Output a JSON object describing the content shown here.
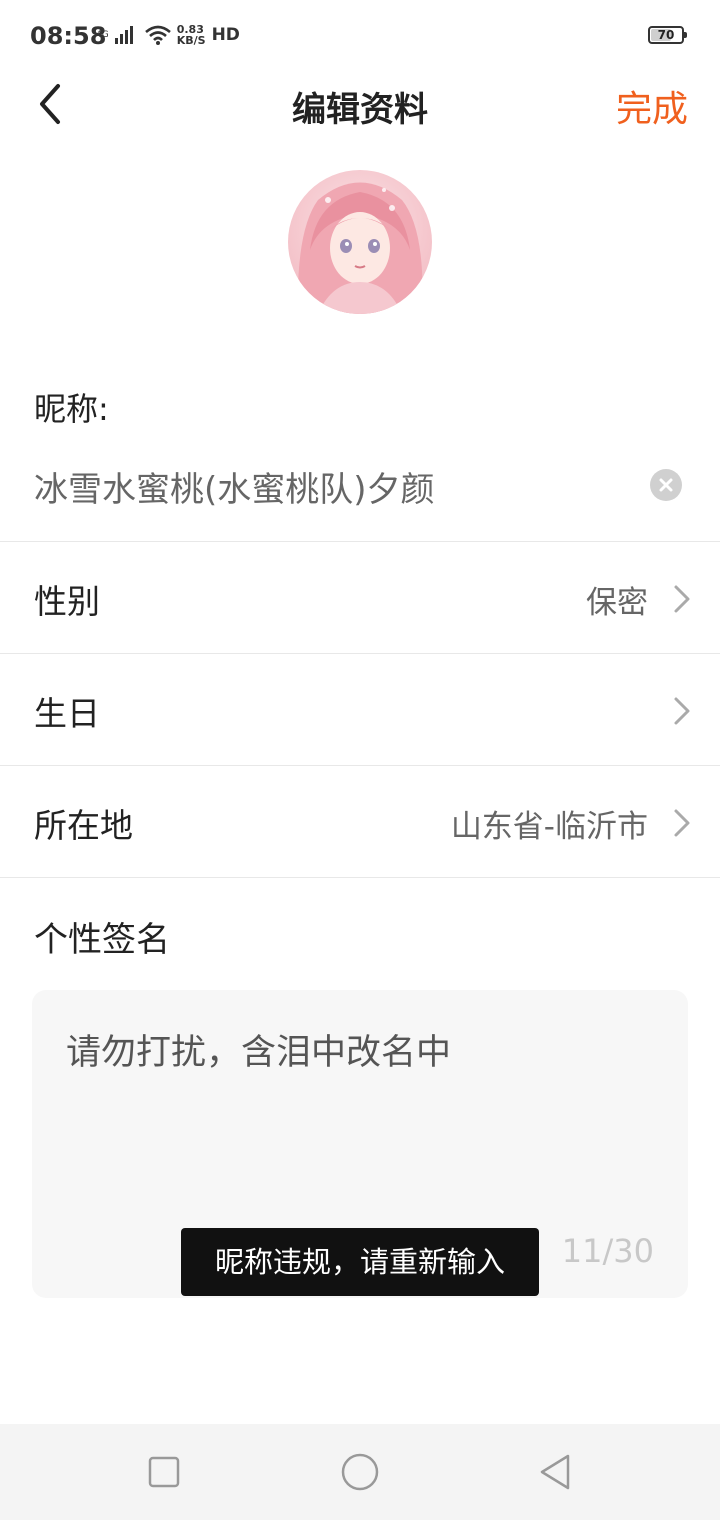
{
  "status_bar": {
    "time": "08:58",
    "network": "4G",
    "speed_value": "0.83",
    "speed_unit": "KB/S",
    "hd": "HD",
    "battery": "70",
    "battery_level": 0.7
  },
  "header": {
    "title": "编辑资料",
    "done_label": "完成",
    "accent_color": "#f0601e"
  },
  "avatar": {
    "icon": "anime-girl-avatar"
  },
  "nickname": {
    "label": "昵称:",
    "value": "冰雪水蜜桃(水蜜桃队)夕颜"
  },
  "rows": [
    {
      "label": "性别",
      "value": "保密"
    },
    {
      "label": "生日",
      "value": ""
    },
    {
      "label": "所在地",
      "value": "山东省-临沂市"
    }
  ],
  "signature": {
    "label": "个性签名",
    "value": "请勿打扰，含泪中改名中",
    "counter": "11/30"
  },
  "toast": {
    "message": "昵称违规，请重新输入"
  },
  "nav_bar": {
    "recents_icon": "square-icon",
    "home_icon": "circle-icon",
    "back_icon": "triangle-back-icon"
  }
}
